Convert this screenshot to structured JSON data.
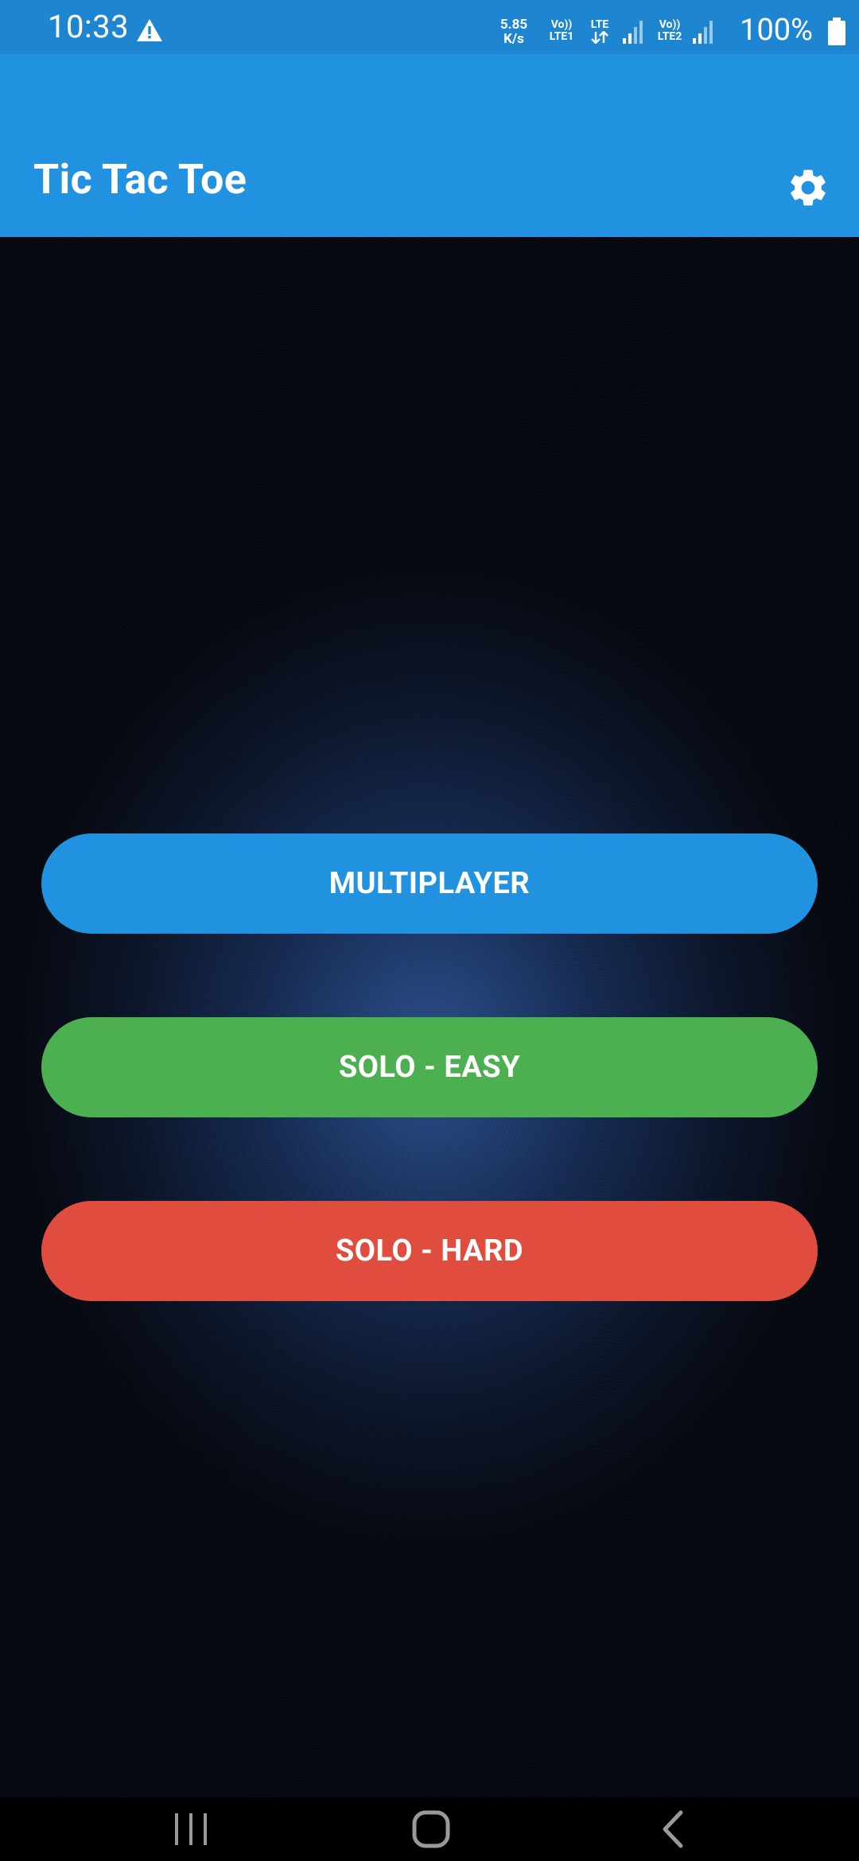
{
  "status_bar": {
    "time": "10:33",
    "net_speed_value": "5.85",
    "net_speed_unit": "K/s",
    "sim1_top": "Vo))",
    "sim1_bottom": "LTE1",
    "sim1_data": "LTE",
    "sim2_top": "Vo))",
    "sim2_bottom": "LTE2",
    "battery": "100%",
    "icons": [
      "warning-icon",
      "data-arrows-icon",
      "signal-icon",
      "signal-icon",
      "battery-icon"
    ]
  },
  "app_bar": {
    "title": "Tic Tac Toe",
    "settings_icon": "gear-icon"
  },
  "menu": {
    "multiplayer_label": "MULTIPLAYER",
    "solo_easy_label": "SOLO - EASY",
    "solo_hard_label": "SOLO - HARD"
  },
  "colors": {
    "status_bar": "#1E86D1",
    "app_bar": "#2192E0",
    "multiplayer": "#2192E0",
    "solo_easy": "#4CB050",
    "solo_hard": "#E04D3F"
  },
  "nav_bar": {
    "icons": [
      "recents-icon",
      "home-icon",
      "back-icon"
    ]
  }
}
